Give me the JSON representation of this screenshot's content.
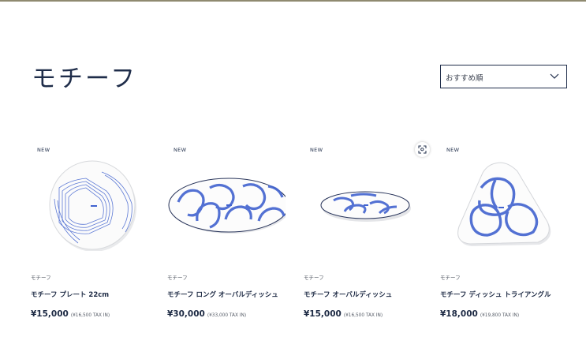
{
  "page": {
    "title": "モチーフ"
  },
  "sort": {
    "selected": "おすすめ順"
  },
  "colors": {
    "navy": "#1f2d4a",
    "pattern_blue": "#3e5ec9",
    "top_bar": "#8f8a70"
  },
  "products": [
    {
      "badge": "NEW",
      "category": "モチーフ",
      "name": "モチーフ プレート 22cm",
      "price": "¥15,000",
      "tax": "(¥16,500 TAX IN)"
    },
    {
      "badge": "NEW",
      "category": "モチーフ",
      "name": "モチーフ ロング オーバルディッシュ",
      "price": "¥30,000",
      "tax": "(¥33,000 TAX IN)"
    },
    {
      "badge": "NEW",
      "category": "モチーフ",
      "name": "モチーフ オーバルディッシュ",
      "price": "¥15,000",
      "tax": "(¥16,500 TAX IN)"
    },
    {
      "badge": "NEW",
      "category": "モチーフ",
      "name": "モチーフ ディッシュ トライアングル",
      "price": "¥18,000",
      "tax": "(¥19,800 TAX IN)"
    }
  ],
  "icons": {
    "zoom": "zoom-expand-icon",
    "sort_chevron": "chevron-down-icon"
  }
}
